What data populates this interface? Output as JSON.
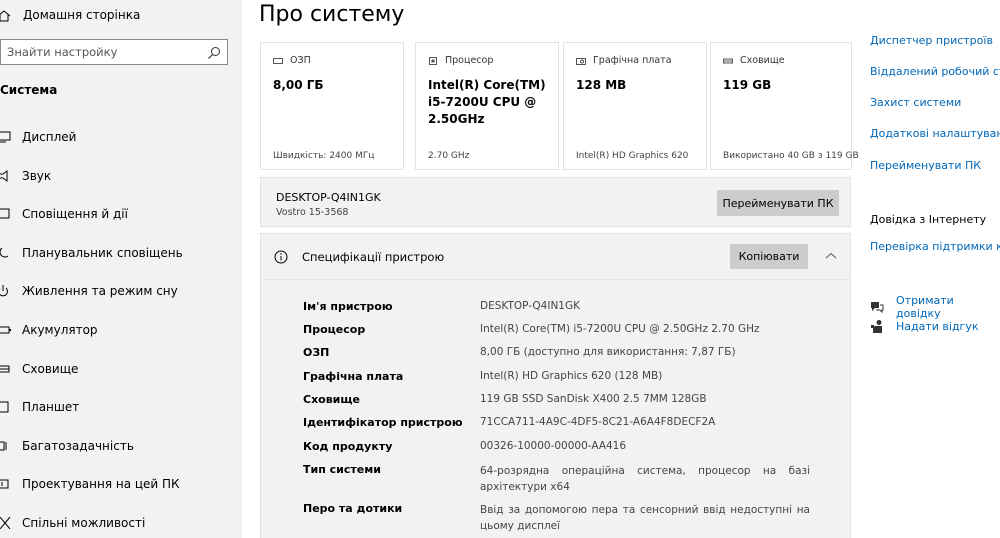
{
  "sidebar": {
    "home_label": "Домашня сторінка",
    "search_placeholder": "Знайти настройку",
    "section_title": "Система",
    "items": [
      {
        "label": "Дисплей",
        "icon": "display-icon"
      },
      {
        "label": "Звук",
        "icon": "sound-icon"
      },
      {
        "label": "Сповіщення й дії",
        "icon": "notifications-icon"
      },
      {
        "label": "Планувальник сповіщень",
        "icon": "focus-assist-icon"
      },
      {
        "label": "Живлення та режим сну",
        "icon": "power-icon"
      },
      {
        "label": "Акумулятор",
        "icon": "battery-icon"
      },
      {
        "label": "Сховище",
        "icon": "storage-icon"
      },
      {
        "label": "Планшет",
        "icon": "tablet-icon"
      },
      {
        "label": "Багатозадачність",
        "icon": "multitasking-icon"
      },
      {
        "label": "Проектування на цей ПК",
        "icon": "projecting-icon"
      },
      {
        "label": "Спільні можливості",
        "icon": "shared-experiences-icon"
      }
    ]
  },
  "main": {
    "title": "Про систему",
    "cards": [
      {
        "label": "ОЗП",
        "value": "8,00 ГБ",
        "footer": "Швидкість: 2400 МГц",
        "icon": "ram-icon"
      },
      {
        "label": "Процесор",
        "value": "Intel(R) Core(TM) i5-7200U CPU @ 2.50GHz",
        "footer": "2.70 GHz",
        "icon": "processor-icon"
      },
      {
        "label": "Графічна плата",
        "value": "128 MB",
        "footer": "Intel(R) HD Graphics 620",
        "icon": "graphics-icon"
      },
      {
        "label": "Сховище",
        "value": "119 GB",
        "footer": "Використано 40 GB з 119 GB",
        "icon": "storage-icon"
      }
    ],
    "pc": {
      "name": "DESKTOP-Q4IN1GK",
      "model": "Vostro 15-3568",
      "rename_label": "Перейменувати ПК"
    },
    "specs": {
      "title": "Специфікації пристрою",
      "copy_label": "Копіювати",
      "rows": [
        {
          "key": "Ім'я пристрою",
          "value": "DESKTOP-Q4IN1GK"
        },
        {
          "key": "Процесор",
          "value": "Intel(R) Core(TM) i5-7200U CPU @ 2.50GHz   2.70 GHz"
        },
        {
          "key": "ОЗП",
          "value": "8,00 ГБ (доступно для використання: 7,87 ГБ)"
        },
        {
          "key": "Графічна плата",
          "value": "Intel(R) HD Graphics 620 (128 MB)"
        },
        {
          "key": "Сховище",
          "value": "119 GB SSD SanDisk X400 2.5 7MM 128GB"
        },
        {
          "key": "Ідентифікатор пристрою",
          "value": "71CCA711-4A9C-4DF5-8C21-A6A4F8DECF2A"
        },
        {
          "key": "Код продукту",
          "value": "00326-10000-00000-AA416"
        },
        {
          "key": "Тип системи",
          "value": "64-розрядна операційна система, процесор на базі архітектури x64"
        },
        {
          "key": "Перо та дотики",
          "value": "Ввід за допомогою пера та сенсорний ввід недоступні на цьому дисплеї"
        }
      ]
    }
  },
  "right": {
    "links": [
      "Диспетчер пристроїв",
      "Віддалений робочий стіл",
      "Захист системи",
      "Додаткові налаштування",
      "Перейменувати ПК"
    ],
    "internet_help_title": "Довідка з Інтернету",
    "internet_help_link": "Перевірка підтримки кількох",
    "get_help": "Отримати довідку",
    "feedback": "Надати відгук"
  },
  "colors": {
    "accent": "#0067b8",
    "sidebar_bg": "#f2f2f2",
    "button_bg": "#cccccc"
  }
}
